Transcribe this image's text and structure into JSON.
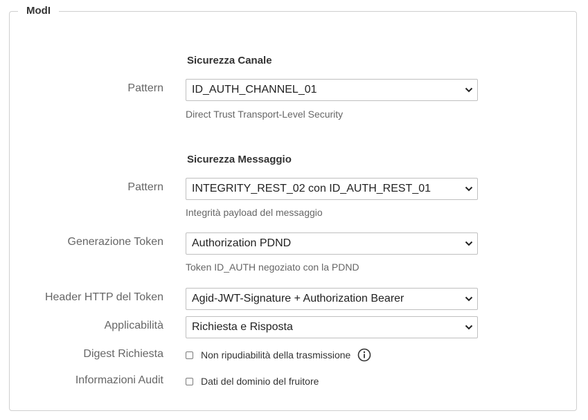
{
  "fieldset": {
    "legend": "ModI"
  },
  "channel": {
    "title": "Sicurezza Canale",
    "pattern_label": "Pattern",
    "pattern_value": "ID_AUTH_CHANNEL_01",
    "pattern_help": "Direct Trust Transport-Level Security"
  },
  "message": {
    "title": "Sicurezza Messaggio",
    "pattern_label": "Pattern",
    "pattern_value": "INTEGRITY_REST_02 con ID_AUTH_REST_01",
    "pattern_help": "Integrità payload del messaggio",
    "token_gen_label": "Generazione Token",
    "token_gen_value": "Authorization PDND",
    "token_gen_help": "Token ID_AUTH negoziato con la PDND",
    "token_header_label": "Header HTTP del Token",
    "token_header_value": "Agid-JWT-Signature + Authorization Bearer",
    "applicability_label": "Applicabilità",
    "applicability_value": "Richiesta e Risposta",
    "digest_label": "Digest Richiesta",
    "digest_option": "Non ripudiabilità della trasmissione",
    "digest_checked": false,
    "audit_label": "Informazioni Audit",
    "audit_option": "Dati del dominio del fruitore",
    "audit_checked": false
  },
  "icons": {
    "select_arrow": "chevron-down-icon",
    "digest_info": "info-icon"
  }
}
